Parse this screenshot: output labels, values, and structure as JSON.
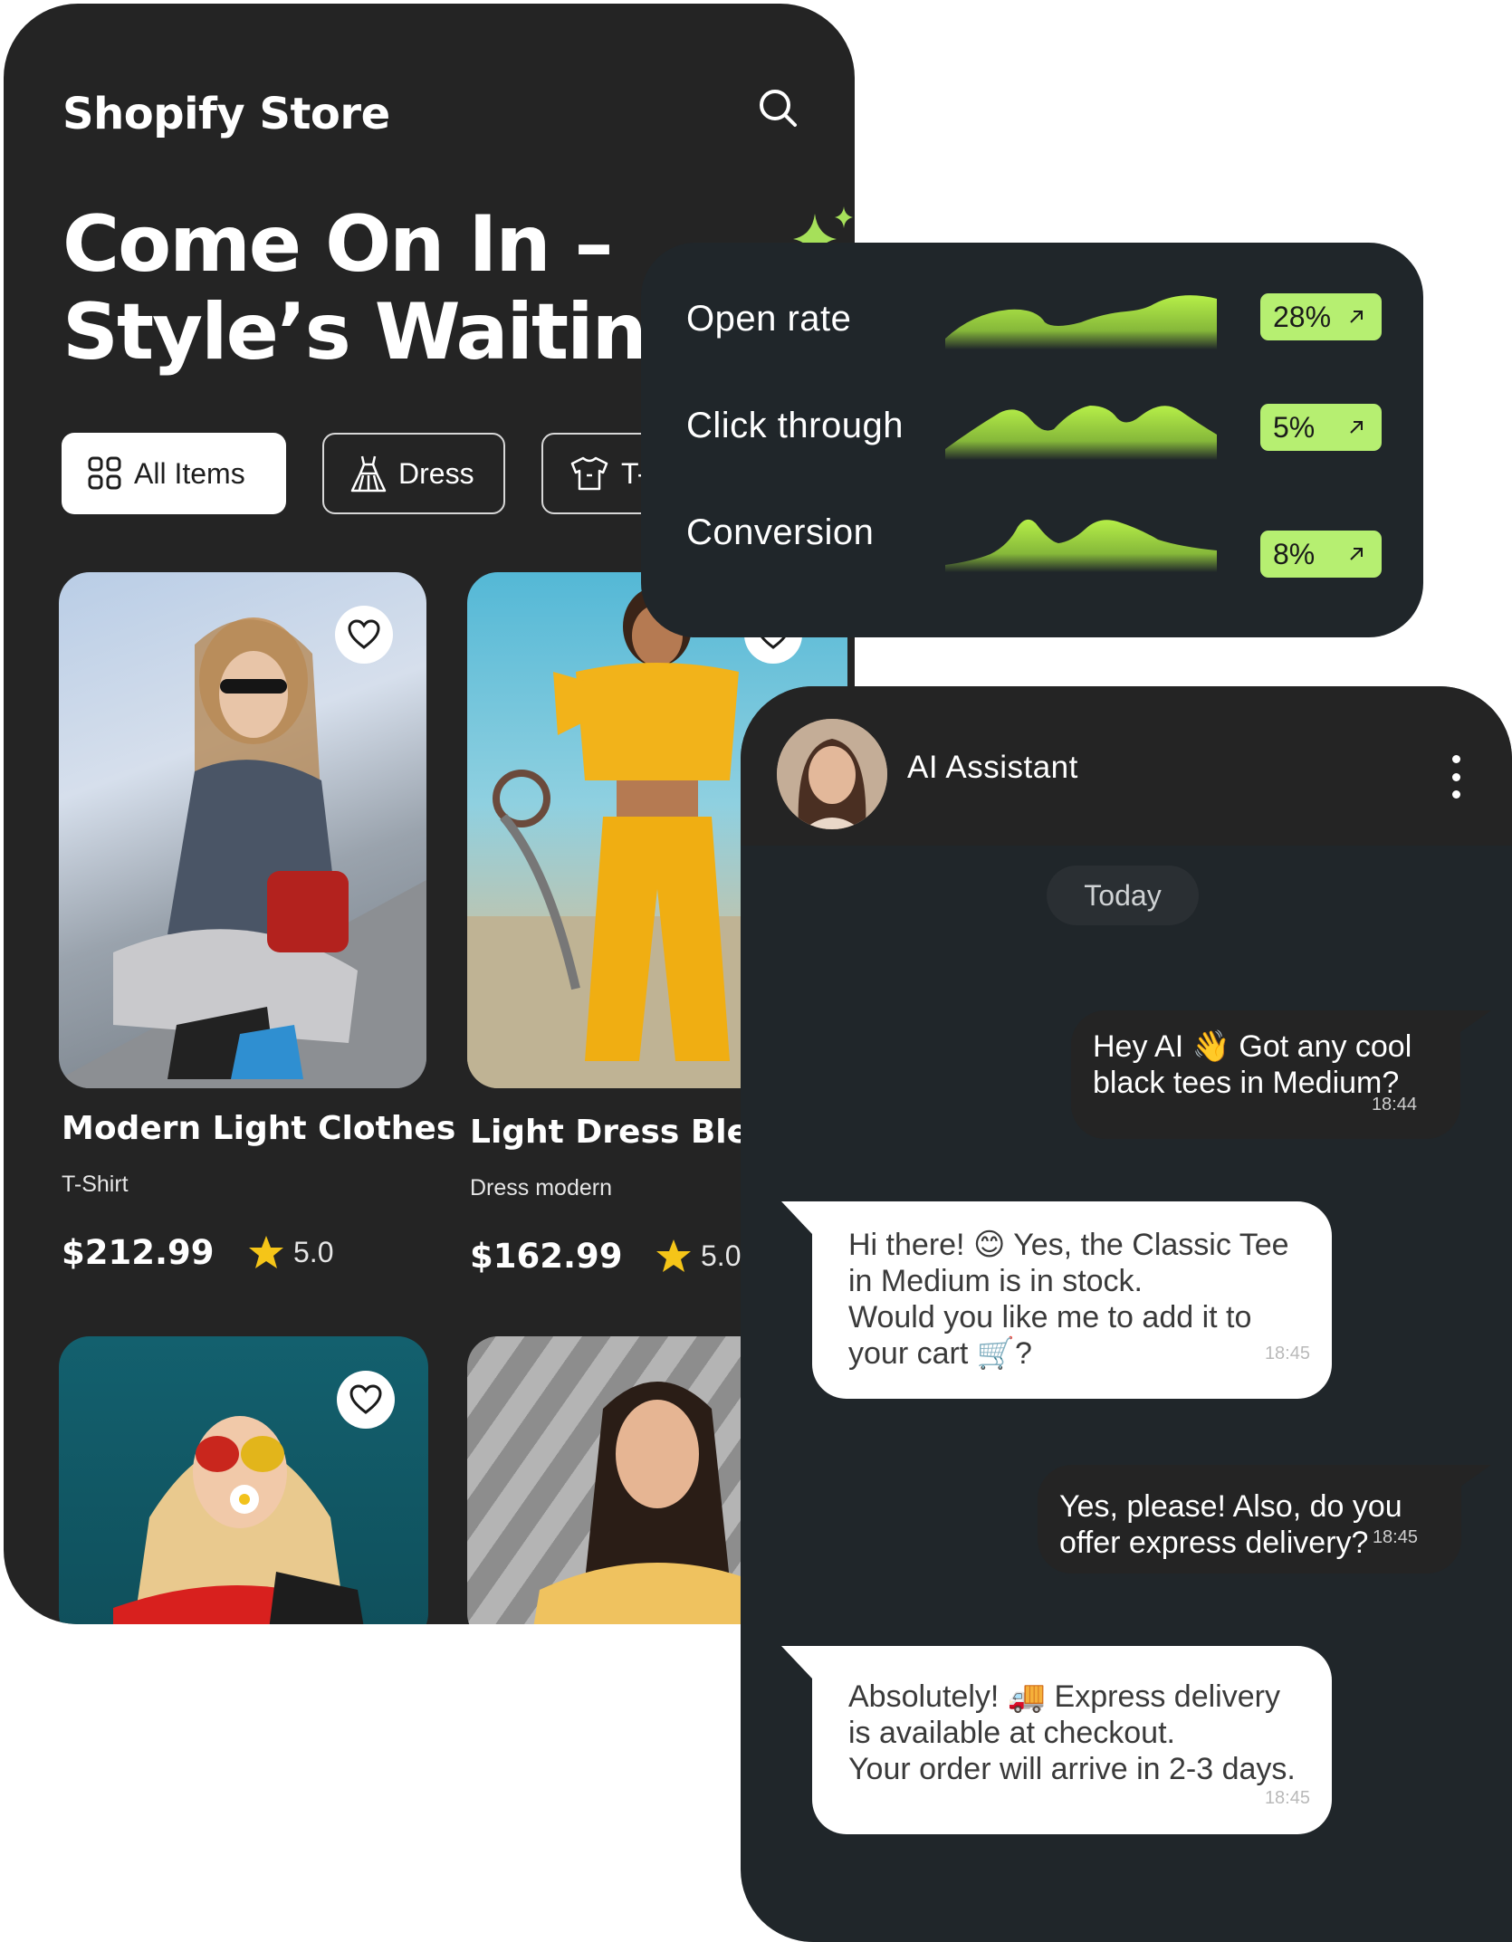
{
  "store": {
    "title": "Shopify Store",
    "headline": "Come On In – Style’s Waiting",
    "chips": [
      {
        "label": "All Items",
        "icon": "grid-icon"
      },
      {
        "label": "Dress",
        "icon": "dress-icon"
      },
      {
        "label": "T-",
        "icon": "tshirt-icon"
      }
    ],
    "products": [
      {
        "name": "Modern Light Clothes",
        "category": "T-Shirt",
        "price": "$212.99",
        "rating": "5.0"
      },
      {
        "name": "Light Dress Bless",
        "category": "Dress modern",
        "price": "$162.99",
        "rating": "5.0"
      }
    ]
  },
  "stats": {
    "accent": "#b6ef71",
    "rows": [
      {
        "label": "Open rate",
        "value": "28%"
      },
      {
        "label": "Click through",
        "value": "5%"
      },
      {
        "label": "Conversion",
        "value": "8%"
      }
    ]
  },
  "chat": {
    "name": "AI Assistant",
    "date_divider": "Today",
    "messages": [
      {
        "from": "user",
        "text": "Hey AI 👋 Got any cool black tees in Medium?",
        "time": "18:44"
      },
      {
        "from": "assistant",
        "text": "Hi there! 😊 Yes, the Classic Tee in Medium is in stock.\nWould you like me to add it to your cart 🛒?",
        "time": "18:45"
      },
      {
        "from": "user",
        "text": "Yes, please! Also, do you offer express delivery?",
        "time": "18:45"
      },
      {
        "from": "assistant",
        "text": "Absolutely! 🚚 Express delivery is available at checkout.\nYour order will arrive in 2-3 days.",
        "time": "18:45"
      }
    ]
  }
}
